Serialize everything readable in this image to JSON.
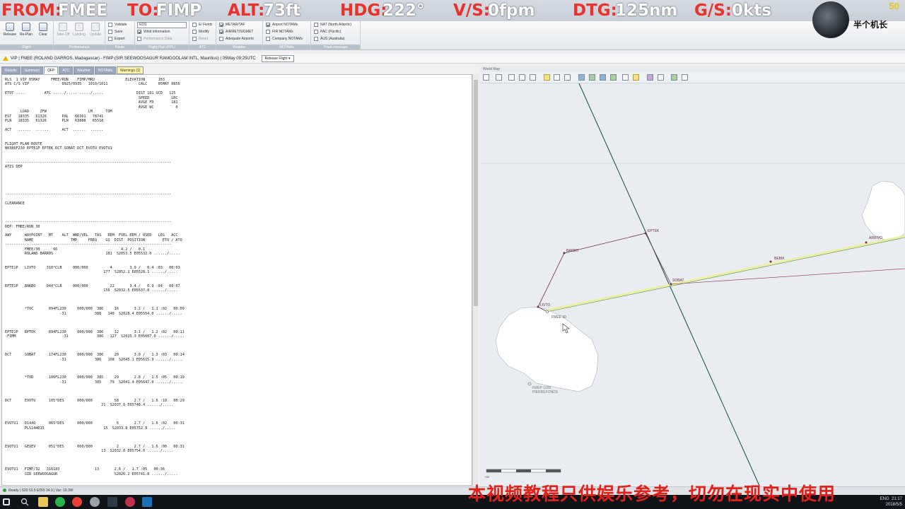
{
  "hud": {
    "from_label": "FROM:",
    "from_value": "FMEE",
    "to_label": "TO:",
    "to_value": "FIMP",
    "alt_label": "ALT:",
    "alt_value": "73ft",
    "hdg_label": "HDG:",
    "hdg_value": "222°",
    "vs_label": "V/S:",
    "vs_value": "0fpm",
    "dtg_label": "DTG:",
    "dtg_value": "125nm",
    "gs_label": "G/S:",
    "gs_value": "0kts"
  },
  "logo": {
    "text": "半个机长",
    "badge": "50"
  },
  "ribbon": {
    "groups": [
      "Flight",
      "Performance",
      "Route",
      "Flight Plan (FPL)",
      "ATC",
      "Weather",
      "NOTAMs",
      "Track message"
    ],
    "flight_buttons": [
      "Release",
      "Re-Plan",
      "Clear"
    ],
    "perf_buttons": [
      "Take-Off",
      "Landing",
      "Update"
    ],
    "route_buttons": [
      "Validate",
      "Save",
      "Export"
    ],
    "fpl_select": "EDS",
    "fpl_items": [
      "Wind information",
      "Performance Data"
    ],
    "atc_items": [
      "E/ Fields",
      "Modify",
      "Reset"
    ],
    "weather_items": [
      "METAR/TAF",
      "AIRMET/SIGMET",
      "Adequate Airports"
    ],
    "notam_items": [
      "Airport NOTAMs",
      "FIR NOTAMs",
      "Company NOTAMs"
    ],
    "track_items": [
      "NAT (North Atlantic)",
      "PAC (Pacific)",
      "AUS (Australia)"
    ]
  },
  "flight_bar": {
    "text": "VIP | FMEE (ROLAND GARROS, Madagascar) - FIMP (SIR SEEWOOSAGUR RAMGOOLAM INTL, Mauritius) | 05May 09:25UTC",
    "release_label": "Release Flight"
  },
  "tabs": [
    "Results",
    "Summary",
    "OFP",
    "ATC",
    "Weather",
    "NOTAMs",
    "Warnings (1)"
  ],
  "ofp_lines": [
    "RLS  1 VIP 05MAY     FMEE/RUN    FIMP/MRU              ELEVATION      183",
    "ATS C/S VIP               0925/0935   1010/1011              CALC     05MAY 0856",
    "",
    "ETOT ....         ATC ...../..... ...../.....               DIST 181 SCD   125",
    "                                                             SPEED          LRC",
    "                                                             AVGE FD        181",
    "                                                             AVGE WC          0",
    "       LOAD     ZFW                   LM      TOM",
    "EST   18335   61326       PAL   66361   78741",
    "PLN   18335   61326       PLN   63888   65518",
    "",
    "ACT   ......  ......      ACT  ......  ......",
    "",
    "",
    "FLIGHT PLAN ROUTE",
    "N0386F230 EPTE1P EPTEK DCT SOBAT DCT EVOTU EVOTU1",
    "",
    "",
    "----------------------------------------------------------------------------",
    "ATIS DEP",
    "",
    "",
    "",
    "",
    "",
    "----------------------------------------------------------------------------",
    "",
    "CLEARANCE",
    "",
    "",
    "",
    "----------------------------------------------------------------------------",
    "DEP: FMEE/RUN 30",
    "",
    "AWY      WAYPOINT   MT    ALT  WND/VEL   TAS   REM  FUEL REM / USED   LEG   ACC",
    "         NAME                 TMP     FREQ    GS  DIST  POSITION        ETO / ATO",
    "----------------------------------------------------------------------------",
    "         FMEE/30      66                             4.2 /   0.1",
    "         ROLAND BARROS                        181  S2053.5 E05532.0 ....../.....",
    "",
    "",
    "EPTE1P   LIVTO     310°CLB     000/000          4        3.9 /   0.4 :03   00:03",
    "                                             177  S2052.1 E05528.1 ....../.....",
    "",
    "",
    "EPTE1P   BAKBO     044°CLB     000/000          22       3.4 /   0.9 :04   00:07",
    "                                             156  S2032.5 E05537.8 ....../.....",
    "",
    "",
    "",
    "         *TOC       094FL230     000/000  386     16       3.2 /   1.1 :02   00:09",
    "                         -31             388   140  S2028.4 E05554.0 ....../.....",
    "",
    "",
    "",
    "EPTE1P   EPTEK      094FL230     000/000  386     12       3.1 /   1.2 :02   00:11",
    "-FIMM                     -31             386   127  S2025.3 E05607.0 ....../.....",
    "",
    "",
    "",
    "DCT      SOBAT      174FL230     000/000  386     20       3.0 /   1.3 :03   00:14",
    "                         -31             386   108  S2045.1 E05615.9 ....../.....",
    "",
    "",
    "",
    "         *TOD       106FL230     000/000  385     29       2.8 /   1.5 :05   00:19",
    "                         -31             385    79  S2041.4 E05647.0 ....../.....",
    "",
    "",
    "",
    "DCT      EVOTU      105°DES      000/000          58       2.7 /   1.6 :10   00:29",
    "                                            21  S2037.6 E05748.4 ....../.....",
    "",
    "",
    "",
    "EVOTU1   D144O      065°DES      000/000           6       2.7 /   1.6 :02   00:31",
    "         PLS144015                           15  S2033.8 E05752.8 ....../.....",
    "",
    "",
    "",
    "EVOTU1   GEVEV      051°DES      000/000           2       2.7 /   1.6 :00   00:31",
    "                                            13  S2032.0 E05754.0 ....../.....",
    "",
    "",
    "",
    "EVOTU1   FIMP/32   316183                13       2.6 /   1.7 :05   00:36",
    "         SIR SEEWOOSAGUR                          S2026.2 E05741.8 ....../....."
  ],
  "map": {
    "header": "World Map",
    "labels": {
      "eptek": "EPTEK",
      "bakbo": "BAKBO",
      "livto": "LIVTO",
      "fmee": "FMEE 30",
      "sobat": "SOBAT",
      "bebik": "BEBIK",
      "arrivo": "ARRIVO",
      "fmep": "FMEP 1020",
      "fmep2": "PIERREFONDS"
    },
    "scale_label": "NM"
  },
  "app_status": "Ready | S20 53.5 E055 34.0 | Var: 19.3W",
  "tray": {
    "time": "21:17",
    "date": "2018/5/5",
    "lang": "ENG"
  },
  "subtitle": "本视频教程只供娱乐参考，切勿在现实中使用"
}
